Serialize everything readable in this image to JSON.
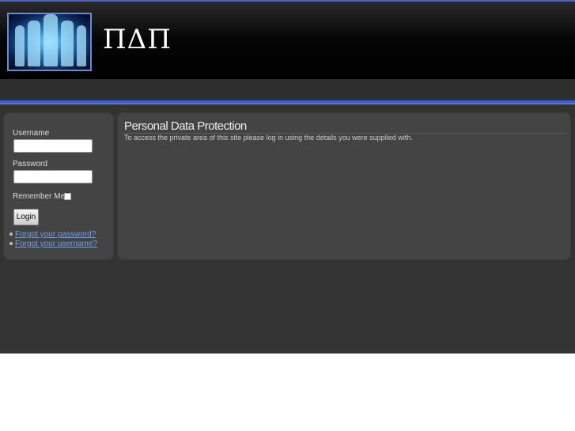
{
  "header": {
    "site_title": "ΠΔΠ",
    "logo_icon": "people-silhouettes-logo"
  },
  "login": {
    "username_label": "Username",
    "username_value": "",
    "password_label": "Password",
    "password_value": "",
    "remember_label": "Remember Me",
    "login_label": "Login",
    "forgot_password": "Forgot your password?",
    "forgot_username": "Forgot your username?"
  },
  "main": {
    "title": "Personal Data Protection",
    "description": "To access the private area of this site please log in using the details you were supplied with."
  },
  "colors": {
    "accent": "#3b5fd6",
    "link": "#6f9ff0"
  }
}
